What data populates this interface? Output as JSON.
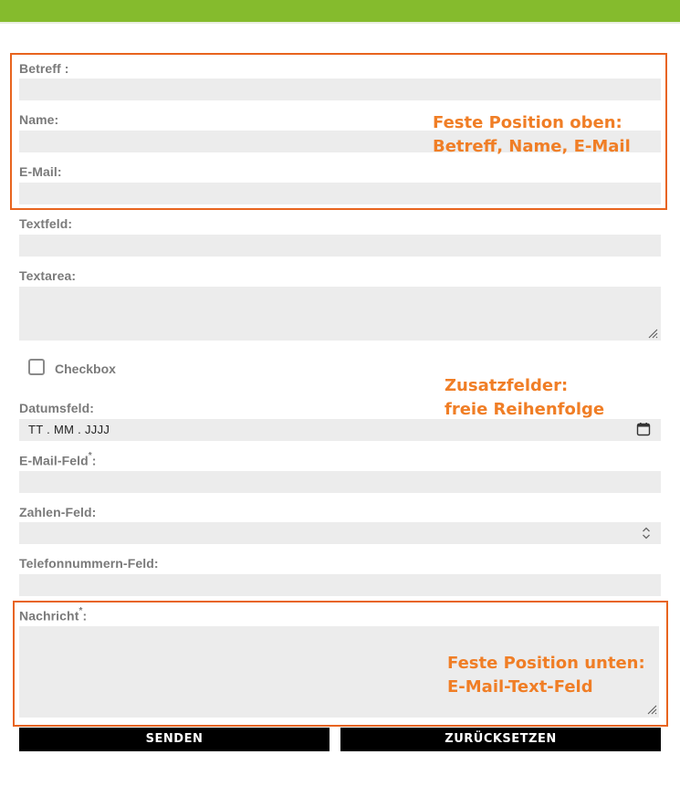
{
  "form": {
    "subject_label": "Betreff :",
    "name_label": "Name:",
    "email_label": "E-Mail:",
    "textfield_label": "Textfeld:",
    "textarea_label": "Textarea:",
    "checkbox_label": "Checkbox",
    "date_label": "Datumsfeld:",
    "date_placeholder": "TT . MM . JJJJ",
    "emailfield_label": "E-Mail-Feld",
    "required_mark": "*",
    "colon": ":",
    "number_label": "Zahlen-Feld:",
    "phone_label": "Telefonnummern-Feld:",
    "message_label": "Nachricht",
    "checkbox_checked": false
  },
  "buttons": {
    "send": "SENDEN",
    "reset": "ZURÜCKSETZEN"
  },
  "annotations": {
    "top_line1": "Feste Position oben:",
    "top_line2": "Betreff, Name, E-Mail",
    "middle_line1": "Zusatzfelder:",
    "middle_line2": "freie Reihenfolge",
    "bottom_line1": "Feste Position unten:",
    "bottom_line2": "E-Mail-Text-Feld"
  },
  "colors": {
    "top_bar": "#85bb2d",
    "annotation": "#f07e26",
    "frame": "#e8641e",
    "field_bg": "#ececec",
    "button_bg": "#000000"
  },
  "icons": {
    "date_picker": "calendar-icon",
    "number_spinner": "spinner-icon",
    "resize": "resize-grip-icon"
  }
}
